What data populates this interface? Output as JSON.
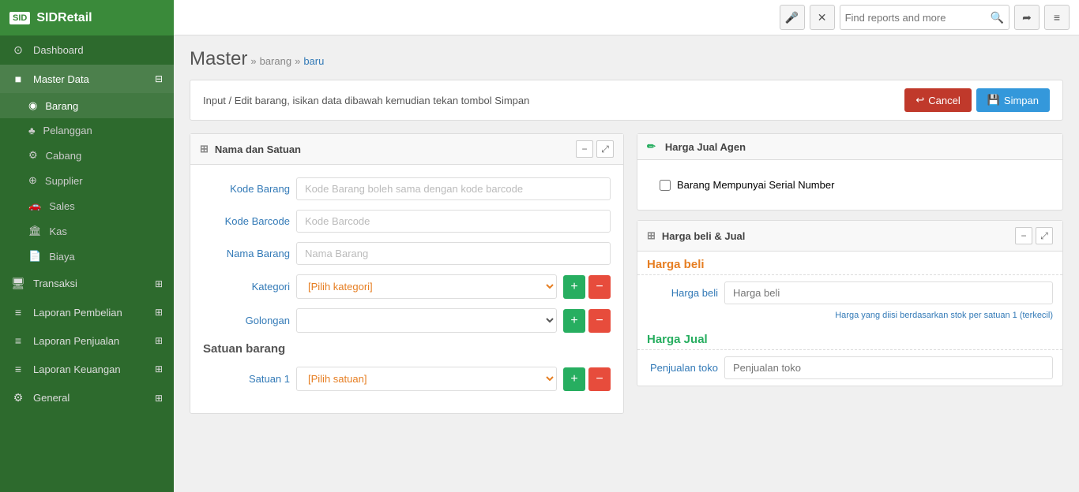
{
  "app": {
    "name": "SIDRetail",
    "logo_text": "SID"
  },
  "topbar": {
    "search_placeholder": "Find reports and more",
    "mic_icon": "🎤",
    "close_icon": "✕",
    "search_icon": "🔍",
    "share_icon": "➦",
    "menu_icon": "≡"
  },
  "breadcrumb": {
    "main": "Master",
    "sep1": "»",
    "link1": "barang",
    "sep2": "»",
    "current": "baru"
  },
  "infobar": {
    "text": "Input / Edit barang, isikan data dibawah kemudian tekan tombol Simpan",
    "cancel_label": "Cancel",
    "simpan_label": "Simpan"
  },
  "sidebar": {
    "items": [
      {
        "id": "dashboard",
        "label": "Dashboard",
        "icon": "⊙",
        "active": false
      },
      {
        "id": "master-data",
        "label": "Master Data",
        "icon": "■",
        "active": true,
        "has_expand": true
      },
      {
        "id": "barang",
        "label": "Barang",
        "icon": "◉",
        "active": true,
        "sub": true
      },
      {
        "id": "pelanggan",
        "label": "Pelanggan",
        "icon": "♠",
        "sub": true
      },
      {
        "id": "cabang",
        "label": "Cabang",
        "icon": "☸",
        "sub": true
      },
      {
        "id": "supplier",
        "label": "Supplier",
        "icon": "⊕",
        "sub": true
      },
      {
        "id": "sales",
        "label": "Sales",
        "icon": "🚗",
        "sub": true
      },
      {
        "id": "kas",
        "label": "Kas",
        "icon": "🏛",
        "sub": true
      },
      {
        "id": "biaya",
        "label": "Biaya",
        "icon": "📄",
        "sub": true
      },
      {
        "id": "transaksi",
        "label": "Transaksi",
        "icon": "🖥",
        "has_expand": true
      },
      {
        "id": "laporan-pembelian",
        "label": "Laporan Pembelian",
        "icon": "≡",
        "has_expand": true
      },
      {
        "id": "laporan-penjualan",
        "label": "Laporan Penjualan",
        "icon": "≡",
        "has_expand": true
      },
      {
        "id": "laporan-keuangan",
        "label": "Laporan Keuangan",
        "icon": "≡",
        "has_expand": true
      },
      {
        "id": "general",
        "label": "General",
        "icon": "⚙",
        "has_expand": true
      }
    ]
  },
  "panel_left": {
    "title": "Nama dan Satuan",
    "fields": {
      "kode_barang": {
        "label": "Kode Barang",
        "placeholder": "Kode Barang boleh sama dengan kode barcode"
      },
      "kode_barcode": {
        "label": "Kode Barcode",
        "placeholder": "Kode Barcode"
      },
      "nama_barang": {
        "label": "Nama Barang",
        "placeholder": "Nama Barang"
      },
      "kategori": {
        "label": "Kategori",
        "placeholder": "[Pilih kategori]"
      },
      "golongan": {
        "label": "Golongan",
        "placeholder": ""
      }
    },
    "satuan_title": "Satuan barang",
    "satuan1_label": "Satuan 1",
    "satuan1_placeholder": "[Pilih satuan]"
  },
  "panel_harga_agen": {
    "title": "Harga Jual Agen",
    "checkbox_label": "Barang Mempunyai Serial Number"
  },
  "panel_harga_beli_jual": {
    "title": "Harga beli & Jual",
    "harga_beli_title": "Harga beli",
    "harga_beli_label": "Harga beli",
    "harga_beli_placeholder": "Harga beli",
    "harga_hint_prefix": "Harga yang diisi",
    "harga_hint_middle": "berdasarkan stok per satuan 1 (terkecil)",
    "harga_jual_title": "Harga Jual",
    "penjualan_toko_label": "Penjualan toko",
    "penjualan_toko_placeholder": "Penjualan toko"
  },
  "colors": {
    "sidebar_bg": "#2d6a2d",
    "sidebar_header": "#3a8a3a",
    "accent_blue": "#337ab7",
    "accent_green": "#27ae60",
    "accent_orange": "#e67e22",
    "btn_cancel": "#c0392b",
    "btn_simpan": "#3498db"
  }
}
